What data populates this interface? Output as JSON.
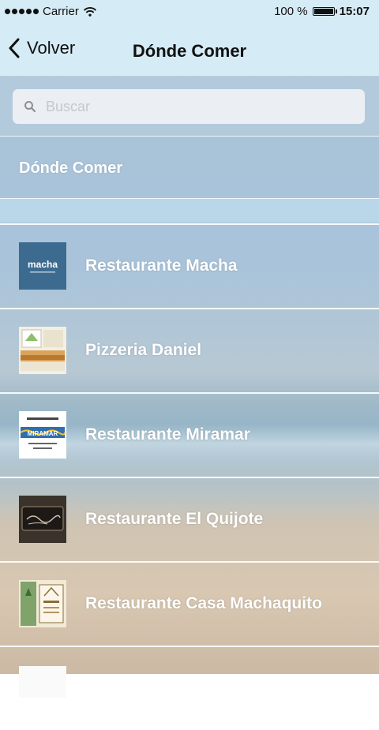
{
  "status_bar": {
    "carrier": "Carrier",
    "battery_percent": "100 %",
    "time": "15:07"
  },
  "nav": {
    "back_label": "Volver",
    "title": "Dónde Comer"
  },
  "search": {
    "placeholder": "Buscar",
    "value": ""
  },
  "section": {
    "title": "Dónde Comer"
  },
  "restaurants": [
    {
      "name": "Restaurante Macha",
      "thumb_icon": "macha-logo",
      "thumb_text": "macha"
    },
    {
      "name": "Pizzeria Daniel",
      "thumb_icon": "pizzeria-daniel-photo"
    },
    {
      "name": "Restaurante Miramar",
      "thumb_icon": "miramar-logo",
      "thumb_text": "MIRAMAR"
    },
    {
      "name": "Restaurante El Quijote",
      "thumb_icon": "el-quijote-sign"
    },
    {
      "name": "Restaurante Casa Machaquito",
      "thumb_icon": "casa-machaquito-logo"
    }
  ],
  "colors": {
    "bar_background": "#d5ebf5",
    "label_text": "#ffffff"
  }
}
